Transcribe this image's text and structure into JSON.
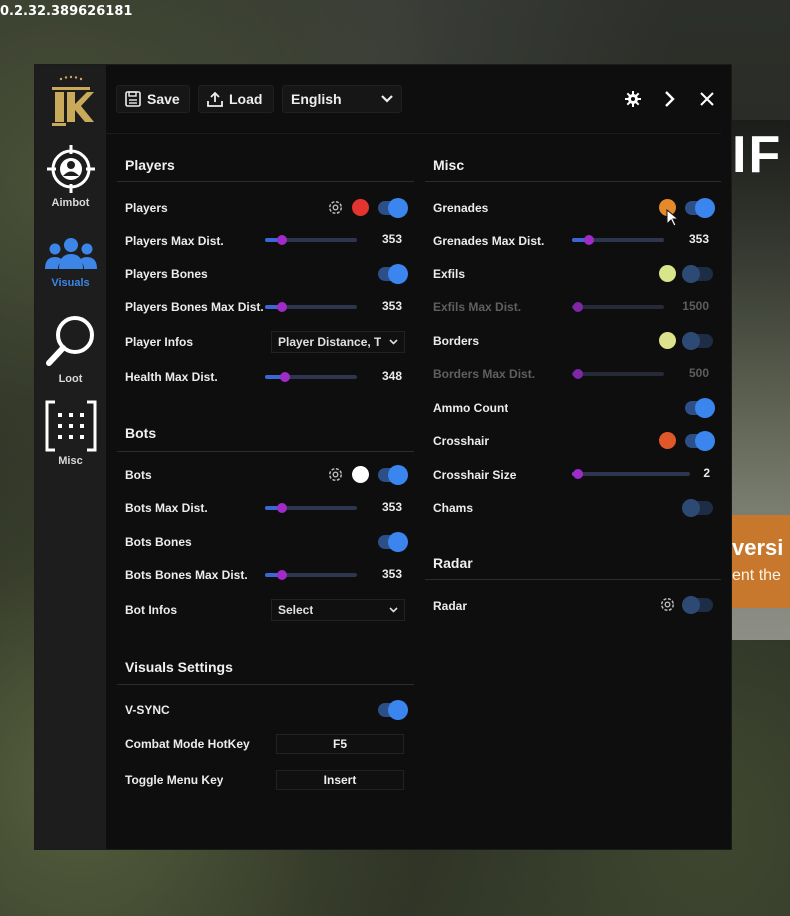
{
  "version_text": "0.2.32.389626181",
  "background": {
    "title": "IF",
    "banner_line1": "versi",
    "banner_line2": "ent the"
  },
  "sidebar": {
    "logo_text": "IK",
    "items": [
      {
        "label": "Aimbot",
        "icon": "crosshair-person-icon"
      },
      {
        "label": "Visuals",
        "icon": "users-icon"
      },
      {
        "label": "Loot",
        "icon": "magnifier-icon"
      },
      {
        "label": "Misc",
        "icon": "grid-dots-icon"
      }
    ]
  },
  "toolbar": {
    "save_label": "Save",
    "load_label": "Load",
    "language": "English"
  },
  "players": {
    "title": "Players",
    "players_label": "Players",
    "players_color": "#e3342f",
    "max_dist_label": "Players Max Dist.",
    "max_dist_value": "353",
    "bones_label": "Players Bones",
    "bones_max_dist_label": "Players Bones Max Dist.",
    "bones_max_dist_value": "353",
    "infos_label": "Player Infos",
    "infos_value": "Player Distance, T",
    "health_label": "Health Max Dist.",
    "health_value": "348"
  },
  "bots": {
    "title": "Bots",
    "bots_label": "Bots",
    "bots_color": "#ffffff",
    "max_dist_label": "Bots Max Dist.",
    "max_dist_value": "353",
    "bones_label": "Bots Bones",
    "bones_max_dist_label": "Bots Bones Max Dist.",
    "bones_max_dist_value": "353",
    "infos_label": "Bot Infos",
    "infos_value": "Select"
  },
  "visuals_settings": {
    "title": "Visuals Settings",
    "vsync_label": "V-SYNC",
    "combat_label": "Combat Mode HotKey",
    "combat_key": "F5",
    "toggle_label": "Toggle Menu Key",
    "toggle_key": "Insert"
  },
  "misc": {
    "title": "Misc",
    "grenades_label": "Grenades",
    "grenades_color": "#e58a2b",
    "grenades_max_label": "Grenades Max Dist.",
    "grenades_max_value": "353",
    "exfils_label": "Exfils",
    "exfils_color": "#d8e58a",
    "exfils_max_label": "Exfils Max Dist.",
    "exfils_max_value": "1500",
    "borders_label": "Borders",
    "borders_color": "#dfe28c",
    "borders_max_label": "Borders Max Dist.",
    "borders_max_value": "500",
    "ammo_label": "Ammo Count",
    "crosshair_label": "Crosshair",
    "crosshair_color": "#e0572a",
    "crosshair_size_label": "Crosshair Size",
    "crosshair_size_value": "2",
    "chams_label": "Chams"
  },
  "radar": {
    "title": "Radar",
    "radar_label": "Radar"
  },
  "accent_color": "#3a86ee"
}
